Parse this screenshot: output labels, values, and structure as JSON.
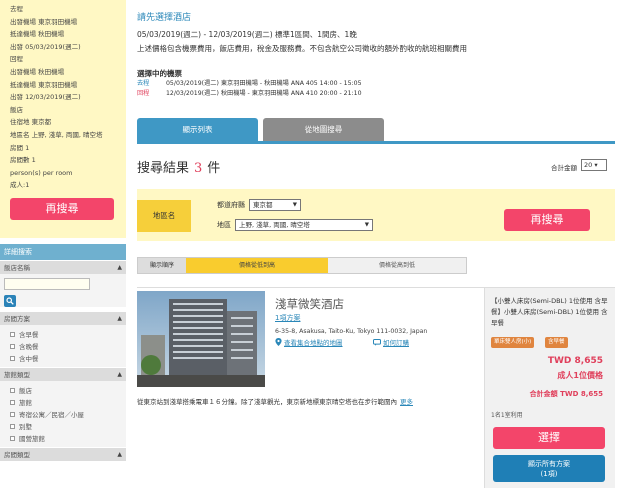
{
  "summary": {
    "outbound_label": "去程",
    "outbound_depart": "出發機場 東京羽田機場",
    "outbound_arrive": "抵達機場 秋田機場",
    "outbound_date": "出發 05/03/2019(週二)",
    "return_label": "回程",
    "return_depart": "出發機場 秋田機場",
    "return_arrive": "抵達機場 東京羽田機場",
    "return_date": "出發 12/03/2019(週二)",
    "hotel_label": "飯店",
    "stay_pref": "住宿地 東京都",
    "area": "地區名 上野, 淺草, 両國, 晴空塔",
    "rooms": "房間 1",
    "nights": "房間數 1",
    "persons_label": "person(s) per room",
    "adults": "成人:1",
    "research_label": "再搜尋"
  },
  "side": {
    "detail_title": "詳細搜索",
    "hotel_name_title": "飯店名稱",
    "meal_title": "房間方案",
    "meals": [
      "含早餐",
      "含晚餐",
      "含中餐"
    ],
    "lodging_title": "旅館類型",
    "lodgings": [
      "飯店",
      "旅館",
      "寄宿公寓／民宿／小屋",
      "別墅",
      "國營旅館"
    ],
    "room_type_title": "房間類型"
  },
  "main": {
    "choose_title": "請先選擇酒店",
    "stay_info": "05/03/2019(週二) - 12/03/2019(週二) 標準1區間、1間房、1晚",
    "price_note": "上述價格包含機票費用，飯店費用，稅金及服務費。不包含航空公司徵收的額外酌收的航班相關費用",
    "selected_title": "選擇中的機票",
    "flights": [
      {
        "tag": "去程",
        "text": "05/03/2019(週二) 東京羽田機場 - 秋田機場 ANA 405 14:00 - 15:05"
      },
      {
        "tag": "回程",
        "text": "12/03/2019(週二) 秋田機場 - 東京羽田機場 ANA 410 20:00 - 21:10"
      }
    ],
    "tab_list": "顯示列表",
    "tab_map": "從地圖搜尋",
    "results_prefix": "搜尋結果",
    "results_count": "3",
    "results_suffix": "件",
    "total_label": "合計金額",
    "per_page": "20",
    "area_label": "地區名",
    "pref_label": "都道府縣",
    "pref_value": "東京都",
    "region_label": "地區",
    "region_value": "上野, 淺草, 両國, 晴空塔",
    "research_label": "再搜尋",
    "sort_label": "顯示順序",
    "sort_low": "價格從低到高",
    "sort_high": "價格從高到低"
  },
  "hotel": {
    "name": "淺草微笑酒店",
    "plan_link": "1項方案",
    "address": "6-35-8, Asakusa, Taito-Ku, Tokyo 111-0032, Japan",
    "map_link": "查看集合地點的地圖",
    "review_link": "如何訂購",
    "description": "從東京站到淺草搭乘電車１６分鐘。除了淺草觀光，東京新地標東京晴空塔也在步行範圍內",
    "more": "更多",
    "room_desc": "【小雙人床房(Semi-DBL) 1位使用 含早餐】小雙人床房(Semi-DBL) 1位使用 含早餐",
    "badge_room": "單床雙人房(小)",
    "badge_meal": "含早餐",
    "price": "TWD 8,655",
    "per_person": "成人1位價格",
    "total": "合計金額 TWD 8,655",
    "stock_note": "1名1室利用",
    "select_label": "選擇",
    "show_all_line1": "顯示所有方案",
    "show_all_line2": "(1項)"
  }
}
